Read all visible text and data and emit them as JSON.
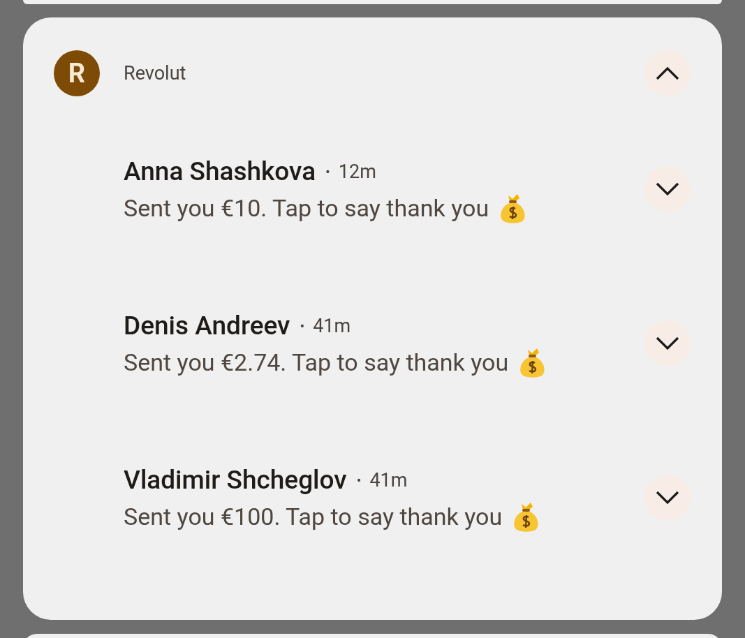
{
  "notification": {
    "app_name": "Revolut",
    "logo_letter": "R",
    "expanded": true,
    "messages": [
      {
        "sender": "Anna Shashkova",
        "separator": "•",
        "time": "12m",
        "text": "Sent you €10. Tap to say thank you",
        "expanded": false
      },
      {
        "sender": "Denis Andreev",
        "separator": "•",
        "time": "41m",
        "text": "Sent you €2.74. Tap to say thank you",
        "expanded": false
      },
      {
        "sender": "Vladimir Shcheglov",
        "separator": "•",
        "time": "41m",
        "text": "Sent you €100. Tap to say thank you",
        "expanded": false
      }
    ]
  }
}
